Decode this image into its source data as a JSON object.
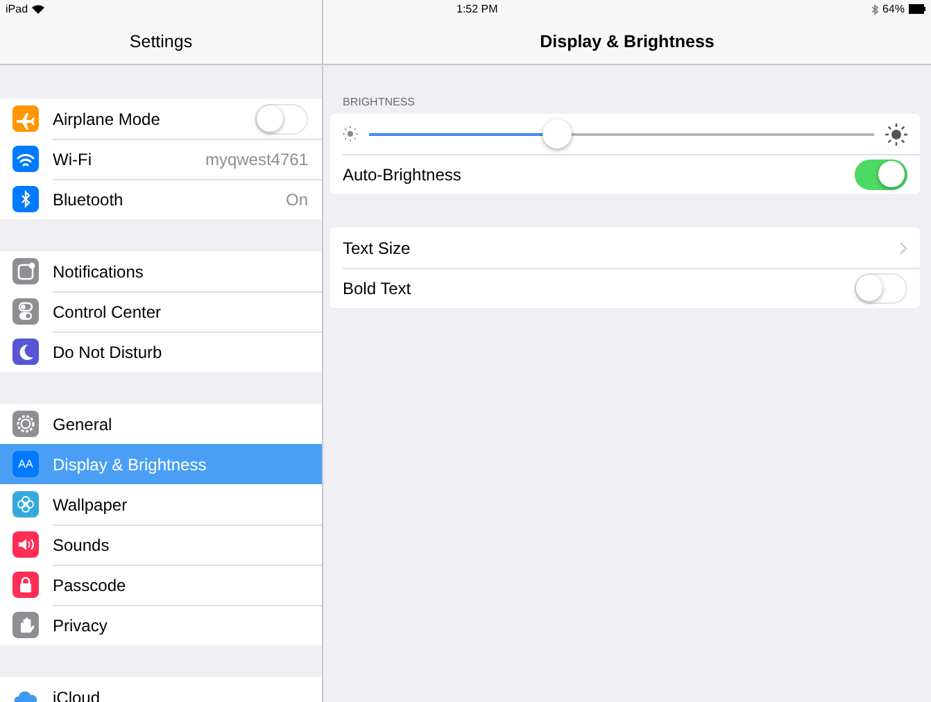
{
  "status_bar": {
    "device": "iPad",
    "time": "1:52 PM",
    "battery": "64%"
  },
  "sidebar": {
    "title": "Settings",
    "groups": [
      [
        {
          "label": "Airplane Mode",
          "kind": "toggle",
          "on": false,
          "color": "#ff9500",
          "selected": false
        },
        {
          "label": "Wi-Fi",
          "kind": "value",
          "value": "myqwest4761",
          "color": "#007aff",
          "selected": false
        },
        {
          "label": "Bluetooth",
          "kind": "value",
          "value": "On",
          "color": "#007aff",
          "selected": false
        }
      ],
      [
        {
          "label": "Notifications",
          "kind": "plain",
          "color": "#8e8e93",
          "selected": false
        },
        {
          "label": "Control Center",
          "kind": "plain",
          "color": "#8e8e93",
          "selected": false
        },
        {
          "label": "Do Not Disturb",
          "kind": "plain",
          "color": "#5856d6",
          "selected": false
        }
      ],
      [
        {
          "label": "General",
          "kind": "plain",
          "color": "#8e8e93",
          "selected": false
        },
        {
          "label": "Display & Brightness",
          "kind": "plain",
          "color": "#007aff",
          "icon_text": "AA",
          "selected": true
        },
        {
          "label": "Wallpaper",
          "kind": "plain",
          "color": "#34aadc",
          "selected": false
        },
        {
          "label": "Sounds",
          "kind": "plain",
          "color": "#ff2d55",
          "selected": false
        },
        {
          "label": "Passcode",
          "kind": "plain",
          "color": "#ff2d55",
          "selected": false
        },
        {
          "label": "Privacy",
          "kind": "plain",
          "color": "#8e8e93",
          "selected": false
        }
      ],
      [
        {
          "label": "iCloud",
          "kind": "plain",
          "color": "#ffffff",
          "selected": false
        }
      ]
    ]
  },
  "detail": {
    "title": "Display & Brightness",
    "sections": [
      {
        "header": "BRIGHTNESS",
        "rows": [
          {
            "kind": "slider",
            "level": 0.37
          },
          {
            "kind": "toggle",
            "label": "Auto-Brightness",
            "on": true
          }
        ]
      },
      {
        "rows": [
          {
            "kind": "disclosure",
            "label": "Text Size"
          },
          {
            "kind": "toggle",
            "label": "Bold Text",
            "on": false
          }
        ]
      }
    ]
  }
}
